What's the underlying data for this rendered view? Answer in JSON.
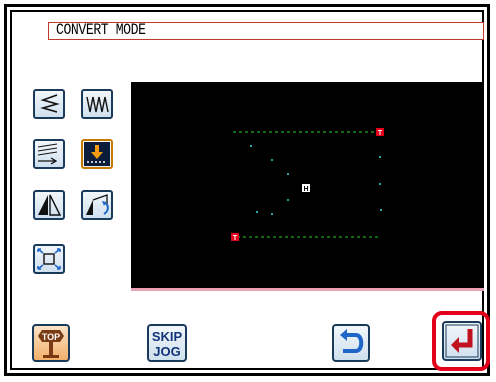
{
  "title": "CONVERT MODE",
  "tools": [
    {
      "name": "mirror-stitch-button",
      "icon": "reverse-stitch-icon"
    },
    {
      "name": "zigzag-button",
      "icon": "zigzag-icon"
    },
    {
      "name": "multiple-stitch-button",
      "icon": "multi-line-icon"
    },
    {
      "name": "offset-down-button",
      "icon": "move-down-icon",
      "active": true
    },
    {
      "name": "symmetry-button",
      "icon": "symmetry-icon"
    },
    {
      "name": "rotate-button",
      "icon": "rotate-icon"
    },
    {
      "name": "scale-button",
      "icon": "scale-icon"
    }
  ],
  "preview": {
    "start_marker": "T",
    "end_marker": "T",
    "home_marker": "H"
  },
  "buttons": {
    "top_label": "TOP",
    "skip_label_1": "SKIP",
    "skip_label_2": "JOG"
  },
  "colors": {
    "preview_background": "#000000",
    "stitch_color": "#22cc22",
    "marker_color": "#e3001b",
    "highlight": "#e3001b"
  }
}
